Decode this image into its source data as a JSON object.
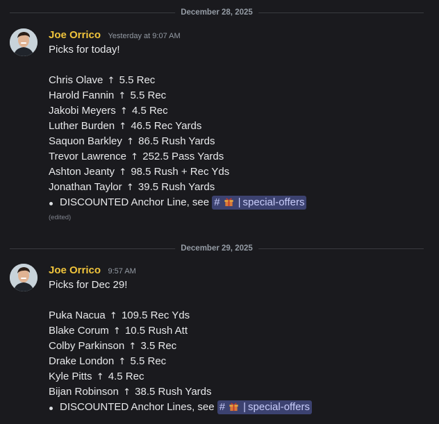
{
  "colors": {
    "background": "#1a1a1e",
    "author": "#f0c43c",
    "mention_bg": "#3c4270",
    "mention_text": "#c9cdfb"
  },
  "icons": {
    "arrow": "up-arrow-icon",
    "channel": "hash-icon",
    "gift": "gift-icon"
  },
  "dividers": [
    {
      "label": "December 28, 2025"
    },
    {
      "label": "December 29, 2025"
    }
  ],
  "messages": [
    {
      "author": "Joe Orrico",
      "timestamp": "Yesterday at 9:07 AM",
      "intro": "Picks for today!",
      "picks": [
        {
          "player": "Chris Olave",
          "arrow": "↑",
          "line": "5.5 Rec"
        },
        {
          "player": "Harold Fannin",
          "arrow": "↑",
          "line": "5.5 Rec"
        },
        {
          "player": "Jakobi Meyers",
          "arrow": "↑",
          "line": "4.5 Rec"
        },
        {
          "player": "Luther Burden",
          "arrow": "↑",
          "line": "46.5 Rec Yards"
        },
        {
          "player": "Saquon Barkley",
          "arrow": "↑",
          "line": "86.5 Rush Yards"
        },
        {
          "player": "Trevor Lawrence",
          "arrow": "↑",
          "line": "252.5 Pass Yards"
        },
        {
          "player": "Ashton Jeanty",
          "arrow": "↑",
          "line": "98.5 Rush + Rec Yds"
        },
        {
          "player": "Jonathan Taylor",
          "arrow": "↑",
          "line": "39.5 Rush Yards"
        }
      ],
      "bullet_text": "DISCOUNTED Anchor Line, see",
      "channel_hash": "#",
      "channel_sep": "|",
      "channel_name": "special-offers",
      "edited": "(edited)"
    },
    {
      "author": "Joe Orrico",
      "timestamp": "9:57 AM",
      "intro": "Picks for Dec 29!",
      "picks": [
        {
          "player": "Puka Nacua",
          "arrow": "↑",
          "line": "109.5 Rec Yds"
        },
        {
          "player": "Blake Corum",
          "arrow": "↑",
          "line": "10.5 Rush Att"
        },
        {
          "player": "Colby Parkinson",
          "arrow": "↑",
          "line": "3.5 Rec"
        },
        {
          "player": "Drake London",
          "arrow": "↑",
          "line": "5.5 Rec"
        },
        {
          "player": "Kyle Pitts",
          "arrow": "↑",
          "line": "4.5 Rec"
        },
        {
          "player": "Bijan Robinson",
          "arrow": "↑",
          "line": "38.5 Rush Yards"
        }
      ],
      "bullet_text": "DISCOUNTED Anchor Lines, see",
      "channel_hash": "#",
      "channel_sep": "|",
      "channel_name": "special-offers"
    }
  ]
}
